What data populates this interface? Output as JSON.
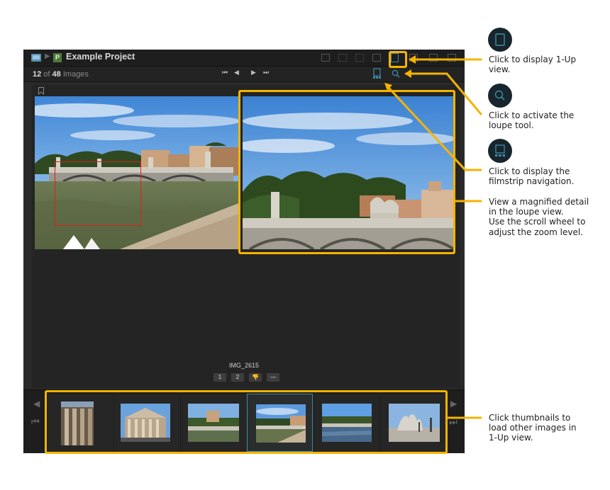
{
  "app": {
    "project_badge": "P",
    "project_title": "Example Project",
    "counter": {
      "current": "12",
      "of": " of ",
      "total": "48",
      "suffix": " Images"
    },
    "nav": {
      "first": "⏮",
      "prev": "◀",
      "next": "▶",
      "last": "⏭"
    },
    "image_name": "IMG_2615",
    "rating_buttons": [
      "1",
      "2",
      "👎",
      "—"
    ],
    "colors": {
      "accent": "#3d8ca8",
      "highlight": "#f5b400",
      "selection_box": "#e0201a"
    }
  },
  "filmstrip": {
    "active_index": 3,
    "thumbnails": [
      "pantheon-columns",
      "pantheon-facade",
      "castel-sant-angelo",
      "ponte-vittorio-emanuele",
      "tiber-river",
      "bridge-statue"
    ]
  },
  "callouts": [
    {
      "icon": "one-up-view-icon",
      "text_line1": "Click to display 1-Up",
      "text_line2": "view."
    },
    {
      "icon": "loupe-icon",
      "text_line1": "Click to activate the",
      "text_line2": "loupe tool."
    },
    {
      "icon": "filmstrip-icon",
      "text_line1": "Click to display the",
      "text_line2": "filmstrip navigation."
    },
    {
      "text_line1": "View a magnified detail",
      "text_line2": "in the loupe view.",
      "text_line3": "Use the scroll wheel to",
      "text_line4": "adjust the zoom level."
    },
    {
      "text_line1": "Click thumbnails to",
      "text_line2": "load other images in",
      "text_line3": "1-Up view."
    }
  ]
}
